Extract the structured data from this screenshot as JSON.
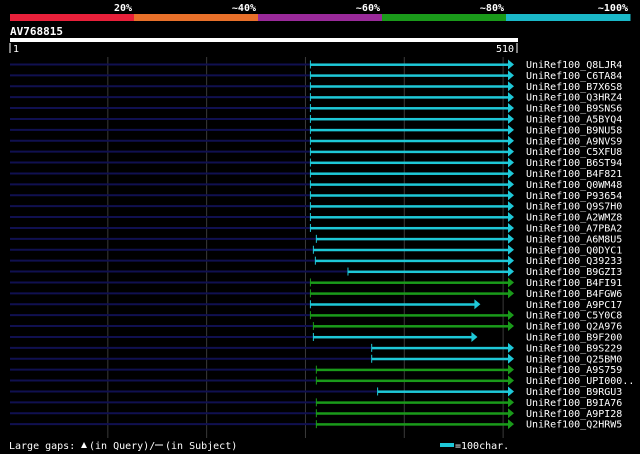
{
  "legend": {
    "segments": [
      {
        "label": "20%",
        "color": "#e8203a"
      },
      {
        "label": "~40%",
        "color": "#e8702a"
      },
      {
        "label": "~60%",
        "color": "#9a2a9a"
      },
      {
        "label": "~80%",
        "color": "#1a9a1a"
      },
      {
        "label": "~100%",
        "color": "#1ab8c8"
      }
    ]
  },
  "query": {
    "name": "AV768815",
    "start_label": "1",
    "end_label": "510",
    "length": 510
  },
  "colors": {
    "cyan": "#1ec8d8",
    "green": "#1a9a1a",
    "navy": "#101050",
    "grid": "#3a3a3a",
    "label": "#ffffff"
  },
  "hits": [
    {
      "id": "UniRef100_Q8LJR4",
      "start": 305,
      "end": 510,
      "color": "cyan",
      "arrow": true
    },
    {
      "id": "UniRef100_C6TA84",
      "start": 305,
      "end": 510,
      "color": "cyan",
      "arrow": true
    },
    {
      "id": "UniRef100_B7X6S8",
      "start": 305,
      "end": 510,
      "color": "cyan",
      "arrow": true
    },
    {
      "id": "UniRef100_Q3HRZ4",
      "start": 305,
      "end": 510,
      "color": "cyan",
      "arrow": true
    },
    {
      "id": "UniRef100_B9SNS6",
      "start": 305,
      "end": 510,
      "color": "cyan",
      "arrow": true
    },
    {
      "id": "UniRef100_A5BYQ4",
      "start": 305,
      "end": 510,
      "color": "cyan",
      "arrow": true
    },
    {
      "id": "UniRef100_B9NU58",
      "start": 305,
      "end": 510,
      "color": "cyan",
      "arrow": true
    },
    {
      "id": "UniRef100_A9NVS9",
      "start": 305,
      "end": 510,
      "color": "cyan",
      "arrow": true
    },
    {
      "id": "UniRef100_C5XFU8",
      "start": 305,
      "end": 510,
      "color": "cyan",
      "arrow": true
    },
    {
      "id": "UniRef100_B6ST94",
      "start": 305,
      "end": 510,
      "color": "cyan",
      "arrow": true
    },
    {
      "id": "UniRef100_B4F821",
      "start": 305,
      "end": 510,
      "color": "cyan",
      "arrow": true
    },
    {
      "id": "UniRef100_Q0WM48",
      "start": 305,
      "end": 510,
      "color": "cyan",
      "arrow": true
    },
    {
      "id": "UniRef100_P93654",
      "start": 305,
      "end": 510,
      "color": "cyan",
      "arrow": true
    },
    {
      "id": "UniRef100_Q9S7H0",
      "start": 305,
      "end": 510,
      "color": "cyan",
      "arrow": true
    },
    {
      "id": "UniRef100_A2WMZ8",
      "start": 305,
      "end": 510,
      "color": "cyan",
      "arrow": true
    },
    {
      "id": "UniRef100_A7PBA2",
      "start": 305,
      "end": 510,
      "color": "cyan",
      "arrow": true
    },
    {
      "id": "UniRef100_A6M8U5",
      "start": 311,
      "end": 510,
      "color": "cyan",
      "arrow": true
    },
    {
      "id": "UniRef100_Q0DYC1",
      "start": 308,
      "end": 510,
      "color": "cyan",
      "arrow": true
    },
    {
      "id": "UniRef100_Q39233",
      "start": 310,
      "end": 510,
      "color": "cyan",
      "arrow": true
    },
    {
      "id": "UniRef100_B9GZI3",
      "start": 343,
      "end": 510,
      "color": "cyan",
      "arrow": true
    },
    {
      "id": "UniRef100_B4FI91",
      "start": 305,
      "end": 510,
      "color": "green",
      "arrow": true
    },
    {
      "id": "UniRef100_B4FGW6",
      "start": 305,
      "end": 510,
      "color": "green",
      "arrow": true
    },
    {
      "id": "UniRef100_A9PC17",
      "start": 305,
      "end": 476,
      "color": "cyan",
      "arrow": true
    },
    {
      "id": "UniRef100_C5Y0C8",
      "start": 305,
      "end": 510,
      "color": "green",
      "arrow": true
    },
    {
      "id": "UniRef100_Q2A976",
      "start": 308,
      "end": 510,
      "color": "green",
      "arrow": true
    },
    {
      "id": "UniRef100_B9F200",
      "start": 308,
      "end": 473,
      "color": "cyan",
      "arrow": true
    },
    {
      "id": "UniRef100_B9S229",
      "start": 367,
      "end": 510,
      "color": "cyan",
      "arrow": true
    },
    {
      "id": "UniRef100_Q25BM0",
      "start": 367,
      "end": 510,
      "color": "cyan",
      "arrow": true
    },
    {
      "id": "UniRef100_A9S759",
      "start": 311,
      "end": 510,
      "color": "green",
      "arrow": true
    },
    {
      "id": "UniRef100_UPI000..",
      "start": 311,
      "end": 510,
      "color": "green",
      "arrow": true
    },
    {
      "id": "UniRef100_B9RGU3",
      "start": 373,
      "end": 510,
      "color": "cyan",
      "arrow": true
    },
    {
      "id": "UniRef100_B9IA76",
      "start": 311,
      "end": 510,
      "color": "green",
      "arrow": true
    },
    {
      "id": "UniRef100_A9PI28",
      "start": 311,
      "end": 510,
      "color": "green",
      "arrow": true
    },
    {
      "id": "UniRef100_Q2HRW5",
      "start": 311,
      "end": 510,
      "color": "green",
      "arrow": true
    }
  ],
  "footer": {
    "gaps_prefix": "Large gaps:",
    "gaps_query": "(in Query)/",
    "gaps_subject": "(in Subject)",
    "scale_label": "=100char."
  }
}
